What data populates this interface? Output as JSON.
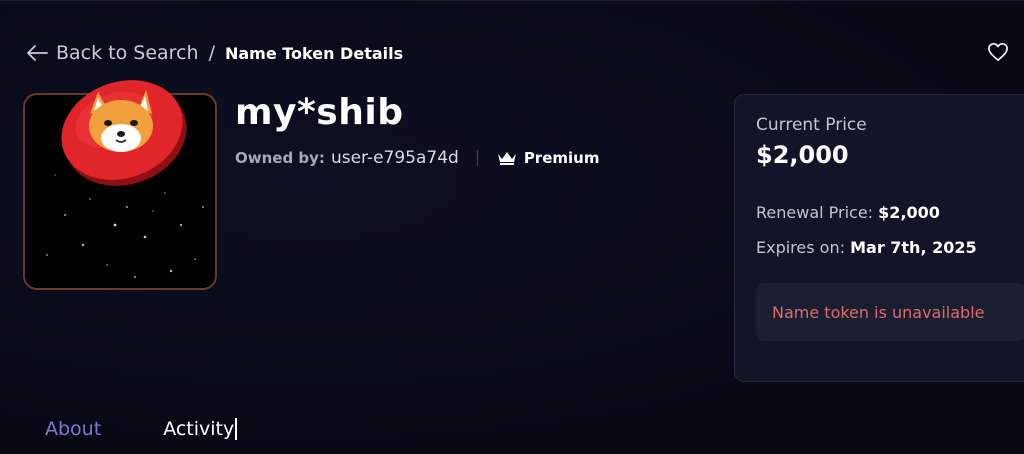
{
  "breadcrumb": {
    "back_label": "Back to Search",
    "separator": "/",
    "current": "Name Token Details"
  },
  "token": {
    "name": "my*shib",
    "owner_label": "Owned by:",
    "owner_value": "user-e795a74d",
    "badge": "Premium"
  },
  "price_card": {
    "current_price_label": "Current Price",
    "current_price": "$2,000",
    "renewal_label": "Renewal Price:",
    "renewal_value": "$2,000",
    "expires_label": "Expires on:",
    "expires_value": "Mar 7th, 2025",
    "status_message": "Name token is unavailable"
  },
  "tabs": [
    {
      "label": "About"
    },
    {
      "label": "Activity"
    }
  ],
  "icons": {
    "back": "arrow-left-icon",
    "favorite": "heart-icon",
    "premium": "crown-icon",
    "token_image": "shiba-coin-icon"
  },
  "colors": {
    "background": "#080a17",
    "card": "#111527",
    "error_text": "#e06a6a",
    "tab_inactive": "#7d79d6",
    "coin_red": "#e1262b"
  }
}
